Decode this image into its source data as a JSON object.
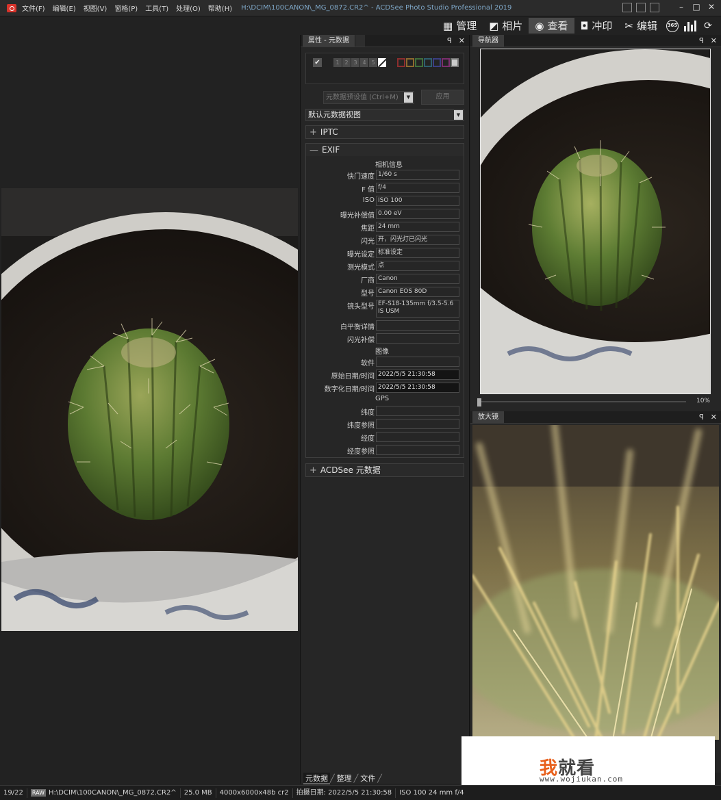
{
  "title_bar": {
    "menus": [
      "文件(F)",
      "编辑(E)",
      "视图(V)",
      "窗格(P)",
      "工具(T)",
      "处理(O)",
      "帮助(H)"
    ],
    "window_title": "H:\\DCIM\\100CANON\\_MG_0872.CR2^ - ACDSee Photo Studio Professional 2019",
    "minimize": "–",
    "maximize": "□",
    "close": "✕"
  },
  "modes": {
    "manage": "管理",
    "photos": "相片",
    "view": "查看",
    "develop": "冲印",
    "edit": "编辑",
    "badge365": "365"
  },
  "properties": {
    "tab_label": "属性 - 元数据",
    "pin": "ꟼ",
    "close": "✕",
    "rating_numbers": [
      "1",
      "2",
      "3",
      "4",
      "5"
    ],
    "label_colors": [
      "#8c2e2e",
      "#8c6a2e",
      "#3f6f3a",
      "#2e5e6e",
      "#3b3f84",
      "#7b2e6e"
    ],
    "preset_placeholder": "元数据预设值 (Ctrl+M)",
    "apply_label": "应用",
    "view_selector": "默认元数据视图",
    "iptc_label": "IPTC",
    "exif_label": "EXIF",
    "acdsee_label": "ACDSee 元数据",
    "expand_sign": "+",
    "collapse_sign": "—",
    "exif": {
      "camera_group": "相机信息",
      "shutter_label": "快门速度",
      "shutter": "1/60 s",
      "fnum_label": "F 值",
      "fnum": "f/4",
      "iso_label": "ISO",
      "iso": "ISO 100",
      "expcomp_label": "曝光补偿值",
      "expcomp": "0.00 eV",
      "focal_label": "焦距",
      "focal": "24 mm",
      "flash_label": "闪光",
      "flash": "开，闪光灯已闪光",
      "expprog_label": "曝光设定",
      "expprog": "标准设定",
      "metering_label": "测光模式",
      "metering": "点",
      "make_label": "厂商",
      "make": "Canon",
      "model_label": "型号",
      "model": "Canon EOS 80D",
      "lens_label": "镜头型号",
      "lens": "EF-S18-135mm f/3.5-5.6 IS USM",
      "wb_label": "白平衡详情",
      "wb": "",
      "flashcomp_label": "闪光补偿",
      "flashcomp": "",
      "image_group": "图像",
      "software_label": "软件",
      "software": "",
      "orig_date_label": "原始日期/时间",
      "orig_date": "2022/5/5 21:30:58",
      "dig_date_label": "数字化日期/时间",
      "dig_date": "2022/5/5 21:30:58",
      "gps_group": "GPS",
      "lat_label": "纬度",
      "lat": "",
      "latref_label": "纬度参照",
      "latref": "",
      "lon_label": "经度",
      "lon": "",
      "lonref_label": "经度参照",
      "lonref": ""
    },
    "bottom_tabs": [
      "元数据",
      "整理",
      "文件"
    ]
  },
  "navigator": {
    "tab_label": "导航器",
    "zoom": "10%"
  },
  "magnifier": {
    "tab_label": "放大镜"
  },
  "watermark": {
    "first_char": "我",
    "rest": "就看",
    "url": "www.wojiukan.com"
  },
  "status_bar": {
    "index": "19/22",
    "raw_badge": "RAW",
    "path": "H:\\DCIM\\100CANON\\_MG_0872.CR2^",
    "size": "25.0 MB",
    "dims": "4000x6000x48b cr2",
    "date": "拍摄日期: 2022/5/5 21:30:58",
    "exposure": "ISO 100   24 mm   f/4"
  }
}
